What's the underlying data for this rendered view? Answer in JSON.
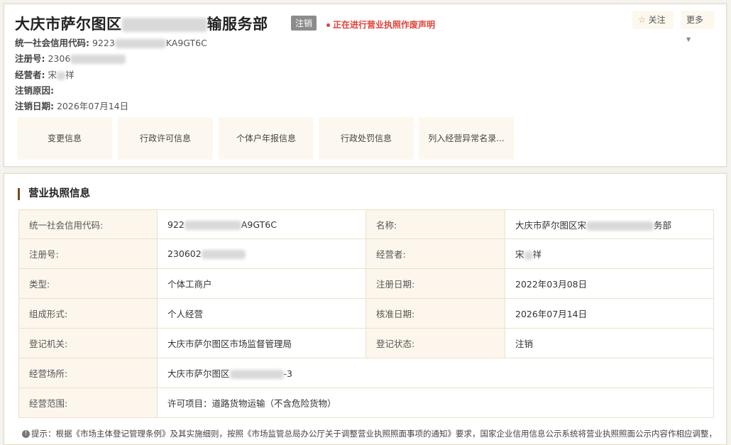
{
  "header": {
    "name_prefix": "大庆市萨尔图区",
    "name_suffix": "输服务部",
    "status_tag": "注销",
    "notice": "正在进行营业执照作废声明",
    "follow_label": "关注",
    "more_label": "更多",
    "credit_code_label": "统一社会信用代码:",
    "credit_code_prefix": "9223",
    "credit_code_suffix": "KA9GT6C",
    "reg_no_label": "注册号:",
    "reg_no_prefix": "2306",
    "operator_label": "经营者:",
    "operator_first": "宋",
    "operator_last": "祥",
    "cancel_reason_label": "注销原因:",
    "cancel_date_label": "注销日期:",
    "cancel_date": "2026年07月14日"
  },
  "tabs": [
    {
      "label": "变更信息"
    },
    {
      "label": "行政许可信息"
    },
    {
      "label": "个体户年报信息"
    },
    {
      "label": "行政处罚信息"
    },
    {
      "label": "列入经营异常名录..."
    }
  ],
  "license": {
    "section_title": "营业执照信息",
    "rows": [
      {
        "k1": "统一社会信用代码:",
        "v1_prefix": "922",
        "v1_suffix": "A9GT6C",
        "k2": "名称:",
        "v2_prefix": "大庆市萨尔图区宋",
        "v2_suffix": "务部"
      },
      {
        "k1": "注册号:",
        "v1_prefix": "230602",
        "v1_suffix": "",
        "k2": "经营者:",
        "v2_prefix": "宋",
        "v2_suffix": "祥"
      },
      {
        "k1": "类型:",
        "v1": "个体工商户",
        "k2": "注册日期:",
        "v2": "2022年03月08日"
      },
      {
        "k1": "组成形式:",
        "v1": "个人经营",
        "k2": "核准日期:",
        "v2": "2026年07月14日"
      },
      {
        "k1": "登记机关:",
        "v1": "大庆市萨尔图区市场监督管理局",
        "k2": "登记状态:",
        "v2": "注销"
      }
    ],
    "address_label": "经营场所:",
    "address_prefix": "大庆市萨尔图区",
    "address_suffix": "-3",
    "scope_label": "经营范围:",
    "scope": "许可项目：道路货物运输（不含危险货物）",
    "tip": "提示：根据《市场主体登记管理条例》及其实施细则，按照《市场监管总局办公厅关于调整营业执照照面事项的通知》要求，国家企业信用信息公示系统将营业执照照面公示内容作相应调整，详见"
  },
  "icons": {
    "follow": "star-outline-icon",
    "more": "caret-down-icon",
    "tip": "info-icon"
  },
  "colors": {
    "accent": "#7a4a1c",
    "notice_red": "#e0423a",
    "tag_gray": "#8c8c8c",
    "header_bg": "#fcf6ec"
  }
}
